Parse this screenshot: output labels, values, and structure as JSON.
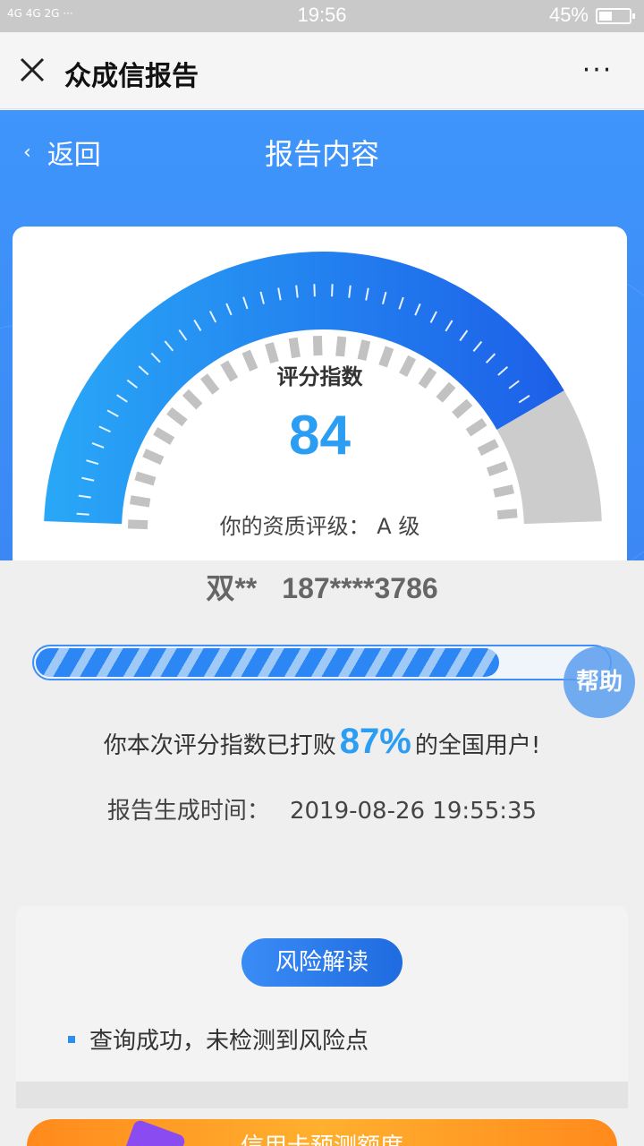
{
  "status_bar": {
    "signal": "4G 4G  2G  ···",
    "time": "19:56",
    "battery": "45%"
  },
  "app_bar": {
    "title": "众成信报告",
    "more": "···"
  },
  "header": {
    "back_label": "返回",
    "title": "报告内容"
  },
  "gauge": {
    "label": "评分指数",
    "score": "84",
    "grade_text": "你的资质评级：  A 级",
    "fill_fraction": 0.84
  },
  "user": {
    "name": "双**",
    "phone": "187****3786"
  },
  "progress": {
    "value": 0.87,
    "help_label": "帮助"
  },
  "beat": {
    "prefix": "你本次评分指数已打败",
    "percent": "87%",
    "suffix": "的全国用户!"
  },
  "report_time": {
    "label": "报告生成时间：",
    "value": "2019-08-26 19:55:35"
  },
  "risk": {
    "button": "风险解读",
    "items": [
      "查询成功，未检测到风险点"
    ]
  },
  "promo": {
    "text": "信用卡预测额度"
  },
  "colors": {
    "primary": "#3f95fb",
    "score": "#2b9df3",
    "gauge_gray": "#cccccc"
  }
}
